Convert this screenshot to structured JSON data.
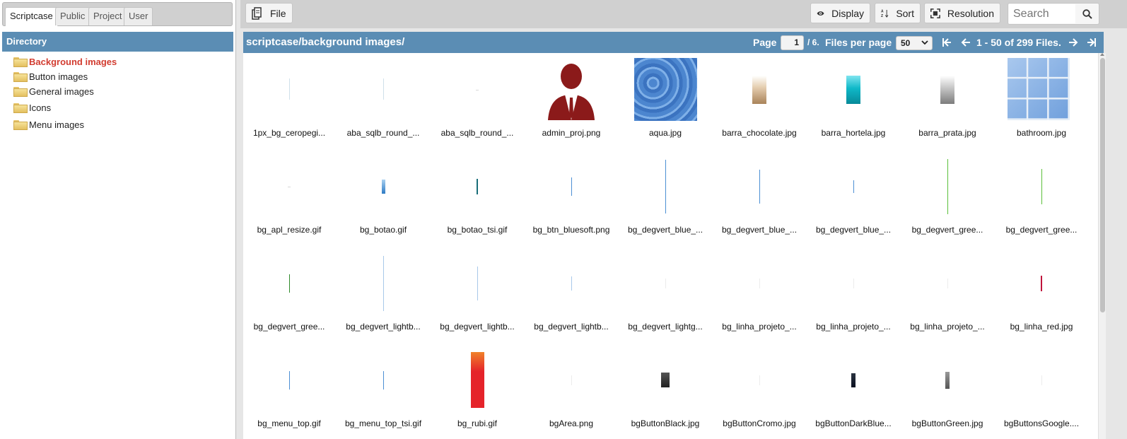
{
  "left_panel": {
    "tabs": [
      {
        "label": "Scriptcase",
        "active": true
      },
      {
        "label": "Public",
        "active": false
      },
      {
        "label": "Project",
        "active": false
      },
      {
        "label": "User",
        "active": false
      }
    ],
    "directory_header": "Directory",
    "tree": [
      {
        "label": "Background images",
        "icon": "folder-icon",
        "active": true
      },
      {
        "label": "Button images",
        "icon": "folder-icon",
        "active": false
      },
      {
        "label": "General images",
        "icon": "folder-icon",
        "active": false
      },
      {
        "label": "Icons",
        "icon": "folder-icon",
        "active": false
      },
      {
        "label": "Menu images",
        "icon": "folder-icon",
        "active": false
      }
    ]
  },
  "toolbar": {
    "file_label": "File",
    "display_label": "Display",
    "sort_label": "Sort",
    "resolution_label": "Resolution",
    "search_placeholder": "Search"
  },
  "pathbar": {
    "path": "scriptcase/background images/",
    "page_label": "Page",
    "page_value": "1",
    "page_total": "/ 6.",
    "files_per_page_label": "Files per page",
    "files_per_page_value": "50",
    "range_text": "1 - 50 of 299 Files."
  },
  "colors": {
    "header_blue": "#5b8db4",
    "active_tree_red": "#d23c30",
    "toolbar_gray": "#d0d0d0"
  },
  "files": [
    {
      "name": "1px_bg_ceropegi...",
      "thumb": "thin-line"
    },
    {
      "name": "aba_sqlb_round_...",
      "thumb": "thin-line"
    },
    {
      "name": "aba_sqlb_round_...",
      "thumb": "dot"
    },
    {
      "name": "admin_proj.png",
      "thumb": "admin-user"
    },
    {
      "name": "aqua.jpg",
      "thumb": "water"
    },
    {
      "name": "barra_chocolate.jpg",
      "thumb": "chocolate-bar"
    },
    {
      "name": "barra_hortela.jpg",
      "thumb": "teal-bar"
    },
    {
      "name": "barra_prata.jpg",
      "thumb": "silver-bar"
    },
    {
      "name": "bathroom.jpg",
      "thumb": "tiles"
    },
    {
      "name": "bg_apl_resize.gif",
      "thumb": "dot"
    },
    {
      "name": "bg_botao.gif",
      "thumb": "blue-small"
    },
    {
      "name": "bg_botao_tsi.gif",
      "thumb": "teal-line"
    },
    {
      "name": "bg_btn_bluesoft.png",
      "thumb": "blue-line"
    },
    {
      "name": "bg_degvert_blue_...",
      "thumb": "blue-tall"
    },
    {
      "name": "bg_degvert_blue_...",
      "thumb": "blue-med"
    },
    {
      "name": "bg_degvert_blue_...",
      "thumb": "blue-short"
    },
    {
      "name": "bg_degvert_gree...",
      "thumb": "green-tall"
    },
    {
      "name": "bg_degvert_gree...",
      "thumb": "green-med"
    },
    {
      "name": "bg_degvert_gree...",
      "thumb": "green-short"
    },
    {
      "name": "bg_degvert_lightb...",
      "thumb": "lightblue-tall"
    },
    {
      "name": "bg_degvert_lightb...",
      "thumb": "lightblue-med"
    },
    {
      "name": "bg_degvert_lightb...",
      "thumb": "lightblue-short"
    },
    {
      "name": "bg_degvert_lightg...",
      "thumb": "faint"
    },
    {
      "name": "bg_linha_projeto_...",
      "thumb": "faint"
    },
    {
      "name": "bg_linha_projeto_...",
      "thumb": "faint"
    },
    {
      "name": "bg_linha_projeto_...",
      "thumb": "faint"
    },
    {
      "name": "bg_linha_red.jpg",
      "thumb": "red-line"
    },
    {
      "name": "bg_menu_top.gif",
      "thumb": "blue-line"
    },
    {
      "name": "bg_menu_top_tsi.gif",
      "thumb": "blue-line"
    },
    {
      "name": "bg_rubi.gif",
      "thumb": "ruby"
    },
    {
      "name": "bgArea.png",
      "thumb": "faint"
    },
    {
      "name": "bgButtonBlack.jpg",
      "thumb": "black-block"
    },
    {
      "name": "bgButtonCromo.jpg",
      "thumb": "faint"
    },
    {
      "name": "bgButtonDarkBlue...",
      "thumb": "darkblue-block"
    },
    {
      "name": "bgButtonGreen.jpg",
      "thumb": "gray-block"
    },
    {
      "name": "bgButtonsGoogle....",
      "thumb": "faint"
    }
  ]
}
